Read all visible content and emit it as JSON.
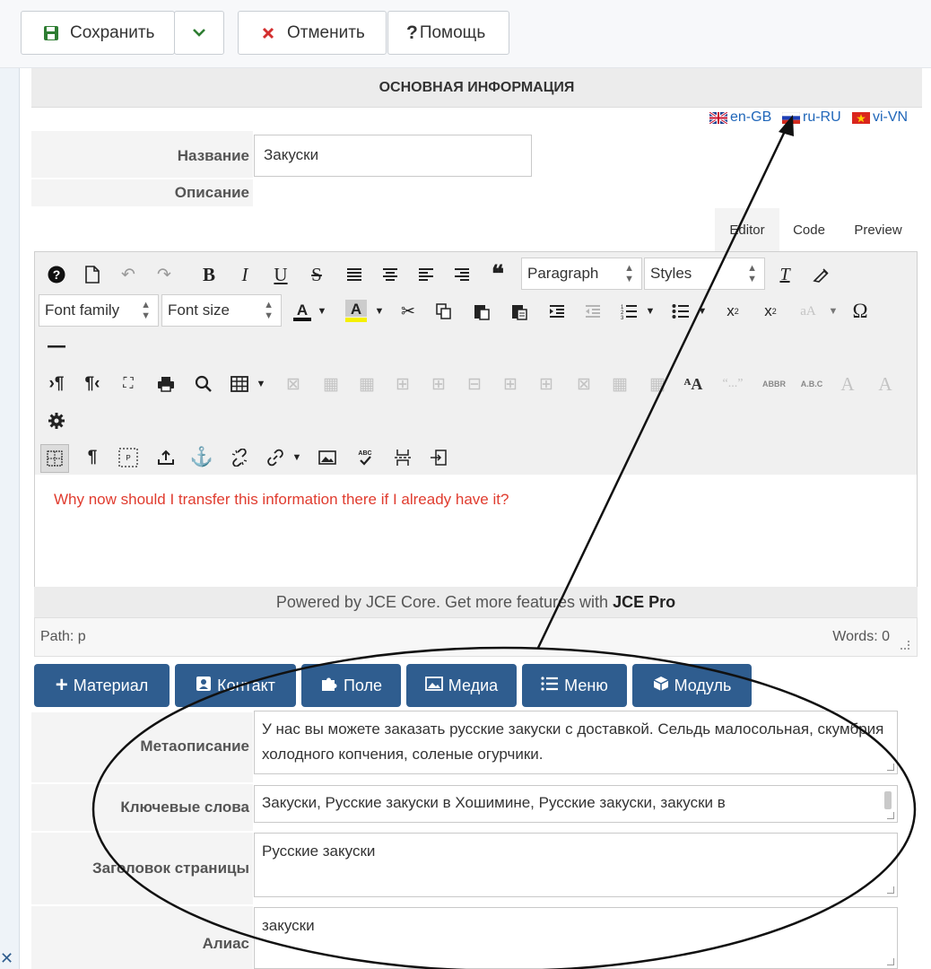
{
  "toolbar": {
    "save_label": "Сохранить",
    "cancel_label": "Отменить",
    "help_label": "Помощь"
  },
  "section": {
    "title": "ОСНОВНАЯ ИНФОРМАЦИЯ"
  },
  "languages": [
    {
      "code": "en-GB",
      "flag": "uk-flag-icon"
    },
    {
      "code": "ru-RU",
      "flag": "russia-flag-icon"
    },
    {
      "code": "vi-VN",
      "flag": "vietnam-flag-icon"
    }
  ],
  "fields": {
    "name_label": "Название",
    "name_value": "Закуски",
    "description_label": "Описание"
  },
  "editor_tabs": {
    "editor": "Editor",
    "code": "Code",
    "preview": "Preview"
  },
  "editor": {
    "format_select": "Paragraph",
    "styles_select": "Styles",
    "font_family_select": "Font family",
    "font_size_select": "Font size",
    "body_text": "Why now should I transfer this information there if I already have it?",
    "powered_text": "Powered by JCE Core. Get more features with ",
    "powered_brand": "JCE Pro",
    "path_label": "Path: p",
    "words_label": "Words: 0"
  },
  "insert_buttons": {
    "material": "Материал",
    "contact": "Контакт",
    "field": "Поле",
    "media": "Медиа",
    "menu": "Меню",
    "module": "Модуль"
  },
  "meta": {
    "metadesc_label": "Метаописание",
    "metadesc_value": "У нас вы можете заказать русские закуски с доставкой. Сельдь малосольная, скумбрия холодного копчения, соленые огурчики.",
    "keywords_label": "Ключевые слова",
    "keywords_value": "Закуски, Русские закуски в Хошимине, Русские закуски, закуски в",
    "page_title_label": "Заголовок страницы",
    "page_title_value": "Русские закуски",
    "alias_label": "Алиас",
    "alias_value": "закуски"
  },
  "colors": {
    "save_icon": "#2e7d32",
    "cancel_icon": "#d32f2f",
    "insert_button_bg": "#2f5d8f",
    "editor_text": "#e03c2f",
    "link": "#1f66b9"
  }
}
